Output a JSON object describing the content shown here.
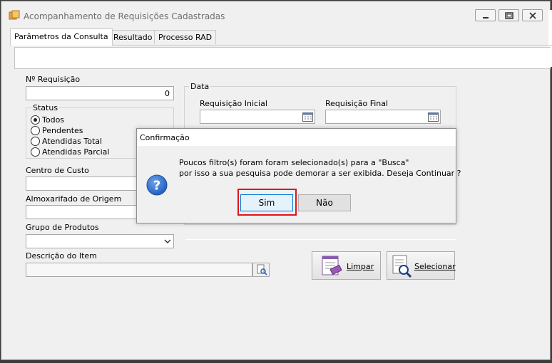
{
  "window": {
    "title": "Acompanhamento de Requisições Cadastradas",
    "controls": {
      "minimize": "minimize-icon",
      "restore": "restore-icon",
      "close": "close-icon"
    }
  },
  "tabs": [
    {
      "label": "Parâmetros da Consulta",
      "active": true
    },
    {
      "label": "Resultado",
      "active": false
    },
    {
      "label": "Processo RAD",
      "active": false
    }
  ],
  "form": {
    "requisicao": {
      "label": "Nº Requisição",
      "value": "0"
    },
    "status": {
      "legend": "Status",
      "options": [
        {
          "label": "Todos",
          "checked": true
        },
        {
          "label": "Pendentes",
          "checked": false
        },
        {
          "label": "Atendidas Total",
          "checked": false
        },
        {
          "label": "Atendidas Parcial",
          "checked": false
        }
      ]
    },
    "centro_custo": {
      "label": "Centro de Custo",
      "value": ""
    },
    "almoxarifado": {
      "label": "Almoxarifado de Origem",
      "value": ""
    },
    "grupo_produtos": {
      "label": "Grupo de Produtos",
      "value": ""
    },
    "descricao_item": {
      "label": "Descrição do Item",
      "value": ""
    },
    "data": {
      "legend": "Data",
      "inicial_label": "Requisição Inicial",
      "final_label": "Requisição Final",
      "inicial_value": "",
      "final_value": ""
    }
  },
  "buttons": {
    "limpar": "Limpar",
    "selecionar": "Selecionar"
  },
  "dialog": {
    "title": "Confirmação",
    "icon": "question-icon",
    "line1": "Poucos filtro(s) foram foram selecionado(s) para a \"Busca\"",
    "line2": "por isso a sua pesquisa pode demorar a ser exibida. Deseja Continuar ?",
    "yes": "Sim",
    "no": "Não"
  },
  "colors": {
    "window_bg": "#f0f0f0",
    "focus_blue": "#0078d7",
    "highlight_red": "#e0141e",
    "icon_blue": "#1f5fbf"
  }
}
